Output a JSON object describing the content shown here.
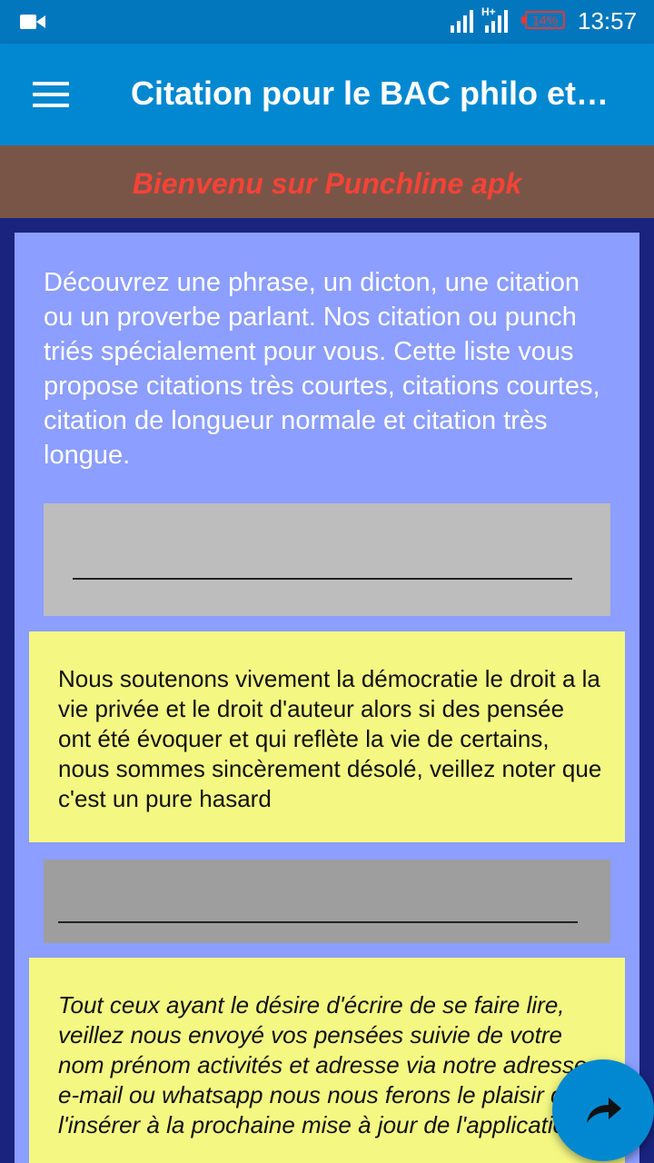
{
  "status_bar": {
    "time": "13:57",
    "battery": "14%",
    "network": "H+",
    "colors": {
      "background": "#0277bd",
      "battery_low": "#e53935"
    }
  },
  "app_bar": {
    "title": "Citation pour le BAC philo et…",
    "menu_icon": "hamburger-menu-icon",
    "color": "#0288d1"
  },
  "welcome_banner": {
    "text": "Bienvenu sur Punchline apk",
    "colors": {
      "background": "#795548",
      "text": "#f44336"
    }
  },
  "content": {
    "intro": "Découvrez une phrase, un dicton, une citation ou un proverbe parlant. Nos citation ou punch triés spécialement pour vous. Cette liste vous propose citations très courtes, citations courtes, citation de longueur normale et citation très longue.",
    "disclaimer": "Nous soutenons vivement la démocratie le droit a la vie privée et le droit d'auteur alors si des pensée ont été évoquer et qui reflète la vie de certains, nous sommes sincèrement désolé, veillez noter que c'est un pure hasard",
    "invitation": "Tout ceux ayant le désire d'écrire de se faire lire, veillez nous envoyé vos pensées suivie de votre nom prénom activités et adresse via notre adresse e-mail ou whatsapp nous nous ferons le plaisir de l'insérer à la prochaine mise à jour de l'application"
  },
  "fab": {
    "icon": "share-arrow-icon"
  },
  "colors": {
    "page_background": "#1a237e",
    "panel": "#8c9eff",
    "card": "#f4f882",
    "separator_light": "#bdbdbd",
    "separator_dark": "#9e9e9e"
  }
}
